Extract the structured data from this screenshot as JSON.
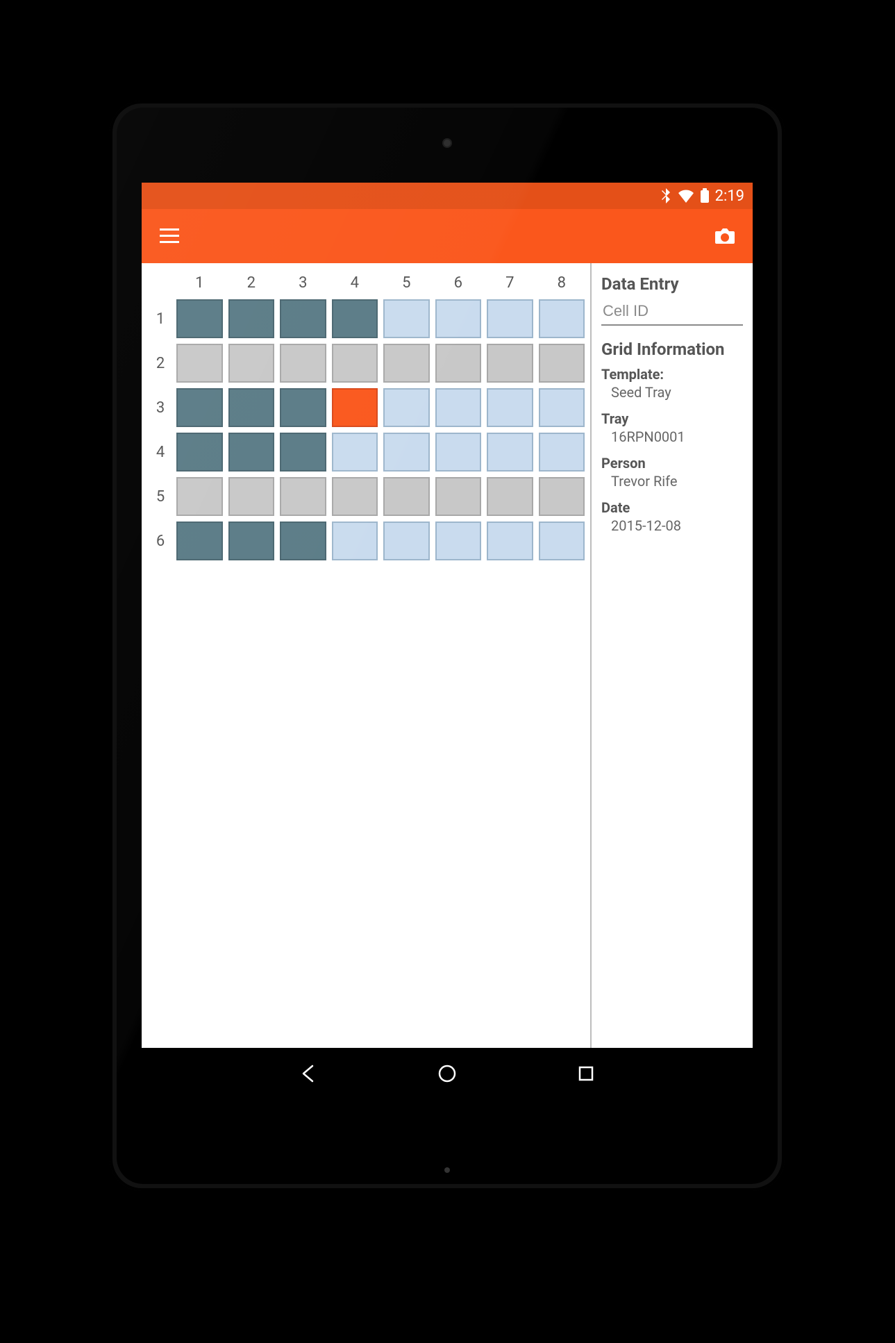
{
  "statusbar": {
    "time": "2:19"
  },
  "grid": {
    "cols": [
      "1",
      "2",
      "3",
      "4",
      "5",
      "6",
      "7",
      "8"
    ],
    "rows": [
      "1",
      "2",
      "3",
      "4",
      "5",
      "6"
    ],
    "selected": [
      3,
      4
    ],
    "cells": [
      [
        "dark",
        "dark",
        "dark",
        "dark",
        "light",
        "light",
        "light",
        "light"
      ],
      [
        "grey",
        "grey",
        "grey",
        "grey",
        "grey",
        "grey",
        "grey",
        "grey"
      ],
      [
        "dark",
        "dark",
        "dark",
        "sel",
        "light",
        "light",
        "light",
        "light"
      ],
      [
        "dark",
        "dark",
        "dark",
        "light",
        "light",
        "light",
        "light",
        "light"
      ],
      [
        "grey",
        "grey",
        "grey",
        "grey",
        "grey",
        "grey",
        "grey",
        "grey"
      ],
      [
        "dark",
        "dark",
        "dark",
        "light",
        "light",
        "light",
        "light",
        "light"
      ]
    ]
  },
  "side": {
    "data_entry_title": "Data Entry",
    "cell_id_placeholder": "Cell ID",
    "grid_info_title": "Grid Information",
    "template_label": "Template:",
    "template_value": "Seed Tray",
    "tray_label": "Tray",
    "tray_value": "16RPN0001",
    "person_label": "Person",
    "person_value": "Trevor Rife",
    "date_label": "Date",
    "date_value": "2015-12-08"
  }
}
